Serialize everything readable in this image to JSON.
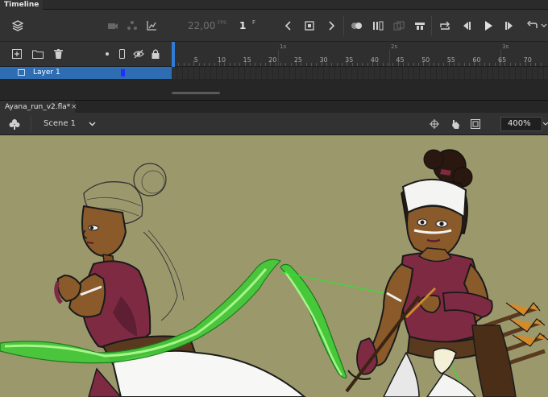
{
  "timeline_panel": {
    "tab_label": "Timeline"
  },
  "toolbar": {
    "fps_value": "22,00",
    "fps_unit": "FPS",
    "frame_value": "1",
    "frame_unit": "F"
  },
  "ruler": {
    "frame_numbers": [
      "5",
      "10",
      "15",
      "20",
      "25",
      "30",
      "35",
      "40",
      "45",
      "50",
      "55",
      "60",
      "65",
      "70"
    ],
    "second_marks": [
      "1s",
      "2s",
      "3s"
    ]
  },
  "layers": [
    {
      "name": "Layer 1",
      "color": "#1f2fff"
    }
  ],
  "document": {
    "tab_label": "Ayana_run_v2.fla*",
    "close_glyph": "×"
  },
  "edit_bar": {
    "scene_label": "Scene 1",
    "zoom": "400%"
  },
  "colors": {
    "stage": "#9b996c",
    "selection": "#2f6db3",
    "panel": "#323232"
  }
}
